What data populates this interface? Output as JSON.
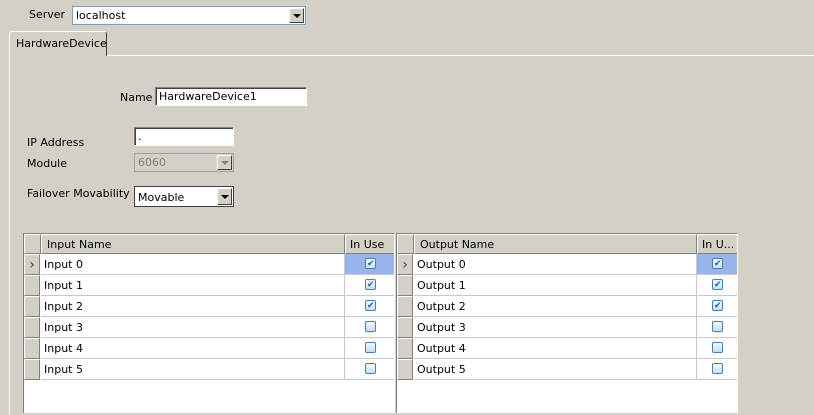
{
  "server": {
    "label": "Server",
    "value": "localhost"
  },
  "tabs": [
    {
      "label": "HardwareDevice"
    }
  ],
  "form": {
    "name_label": "Name",
    "name_value": "HardwareDevice1",
    "ip_label": "IP Address",
    "ip_value": ".",
    "module_label": "Module",
    "module_value": "6060",
    "failover_label": "Failover Movability",
    "failover_value": "Movable"
  },
  "inputs_grid": {
    "columns": [
      "Input Name",
      "In Use"
    ],
    "rows": [
      {
        "name": "Input 0",
        "in_use": true,
        "current": true
      },
      {
        "name": "Input 1",
        "in_use": true
      },
      {
        "name": "Input 2",
        "in_use": true
      },
      {
        "name": "Input 3",
        "in_use": false
      },
      {
        "name": "Input 4",
        "in_use": false
      },
      {
        "name": "Input 5",
        "in_use": false
      }
    ]
  },
  "outputs_grid": {
    "columns": [
      "Output Name",
      "In U..."
    ],
    "rows": [
      {
        "name": "Output 0",
        "in_use": true,
        "current": true
      },
      {
        "name": "Output 1",
        "in_use": true
      },
      {
        "name": "Output 2",
        "in_use": true
      },
      {
        "name": "Output 3",
        "in_use": false
      },
      {
        "name": "Output 4",
        "in_use": false
      },
      {
        "name": "Output 5",
        "in_use": false
      }
    ]
  },
  "icons": {
    "row_indicator": "chevron-right-icon",
    "dropdown": "chevron-down-icon",
    "check": "checkmark-icon"
  },
  "colors": {
    "selection": "#99b4e8",
    "checkbox_border": "#4a7fb5"
  }
}
